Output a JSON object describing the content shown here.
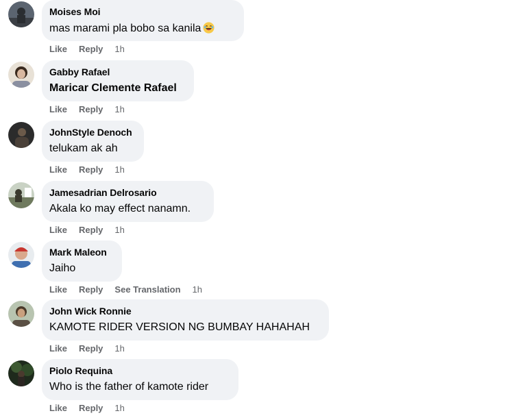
{
  "comments": [
    {
      "author": "Moises Moi",
      "text": "mas marami pla bobo sa kanila",
      "emoji": "laughing-emoji",
      "actions": {
        "like": "Like",
        "reply": "Reply",
        "translate": "",
        "time": "1h"
      }
    },
    {
      "author": "Gabby Rafael",
      "text": "Maricar Clemente Rafael",
      "actions": {
        "like": "Like",
        "reply": "Reply",
        "translate": "",
        "time": "1h"
      }
    },
    {
      "author": "JohnStyle Denoch",
      "text": "telukam ak ah",
      "actions": {
        "like": "Like",
        "reply": "Reply",
        "translate": "",
        "time": "1h"
      }
    },
    {
      "author": "Jamesadrian Delrosario",
      "text": "Akala ko may effect nanamn.",
      "actions": {
        "like": "Like",
        "reply": "Reply",
        "translate": "",
        "time": "1h"
      }
    },
    {
      "author": "Mark Maleon",
      "text": "Jaiho",
      "actions": {
        "like": "Like",
        "reply": "Reply",
        "translate": "See Translation",
        "time": "1h"
      }
    },
    {
      "author": "John Wick Ronnie",
      "text": "KAMOTE RIDER VERSION NG BUMBAY HAHAHAH",
      "actions": {
        "like": "Like",
        "reply": "Reply",
        "translate": "",
        "time": "1h"
      }
    },
    {
      "author": "Piolo Requina",
      "text": "Who is the father of kamote rider",
      "actions": {
        "like": "Like",
        "reply": "Reply",
        "translate": "",
        "time": "1h"
      }
    }
  ]
}
